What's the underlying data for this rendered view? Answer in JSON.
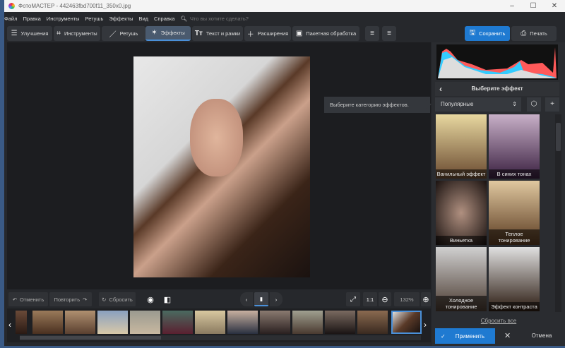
{
  "title": "ФотоМАСТЕР - 442463fbd700f11_350x0.jpg",
  "menu": [
    "Файл",
    "Правка",
    "Инструменты",
    "Ретушь",
    "Эффекты",
    "Вид",
    "Справка"
  ],
  "search_placeholder": "Что вы хотите сделать?",
  "toolbar": {
    "improve": "Улучшения",
    "tools": "Инструменты",
    "retouch": "Ретушь",
    "effects": "Эффекты",
    "text": "Текст и рамки",
    "extensions": "Расширения",
    "batch": "Пакетная обработка",
    "save": "Сохранить",
    "print": "Печать"
  },
  "tooltip": "Выберите категорию эффектов.",
  "panel": {
    "header": "Выберите эффект",
    "category": "Популярные",
    "effects": [
      "Ванильный эффект",
      "В синих тонах",
      "Виньетка",
      "Теплое тонирование",
      "Холодное тонирование",
      "Эффект контраста"
    ],
    "reset_all": "Сбросить все",
    "apply": "Применить",
    "cancel": "Отмена"
  },
  "bottom": {
    "undo": "Отменить",
    "redo": "Повторить",
    "reset": "Сбросить",
    "ratio": "1:1",
    "zoom": "132%"
  },
  "colors": {
    "accent": "#1f7ad1"
  }
}
